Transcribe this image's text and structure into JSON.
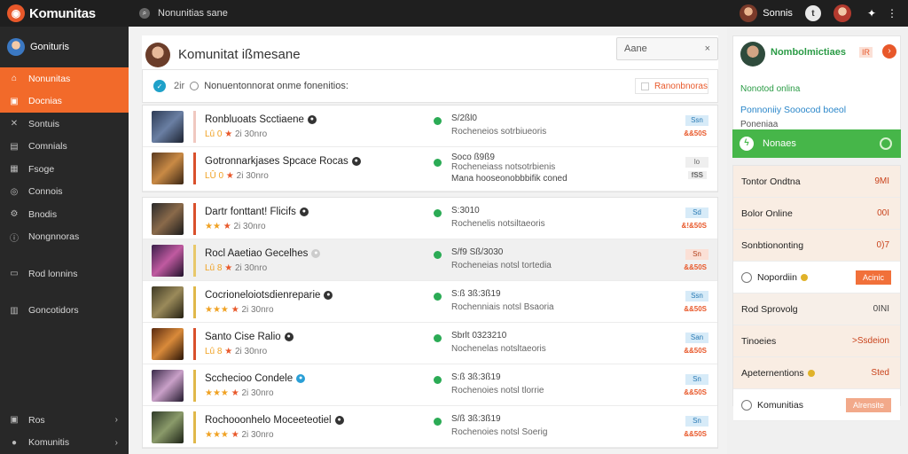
{
  "topbar": {
    "brand": "Komunitas",
    "search_text": "Nonunitias sane",
    "user_name": "Sonnis",
    "circle_label": "t",
    "icons": [
      "search-icon",
      "bell-icon",
      "more-icon"
    ]
  },
  "sidebar": {
    "profile_name": "Gonituris",
    "items": [
      {
        "label": "Nonunitas",
        "icon": "home-icon",
        "active": true
      },
      {
        "label": "Docnias",
        "icon": "folder-icon",
        "active": true
      },
      {
        "label": "Sontuis",
        "icon": "tools-icon"
      },
      {
        "label": "Comnials",
        "icon": "chat-icon"
      },
      {
        "label": "Fsoge",
        "icon": "grid-icon"
      },
      {
        "label": "Connois",
        "icon": "globe-icon"
      },
      {
        "label": "Bnodis",
        "icon": "settings-icon"
      },
      {
        "label": "Nongnnoras",
        "icon": "info-icon"
      },
      {
        "label": "Rod lonnins",
        "icon": "list-icon"
      },
      {
        "label": "Goncotidors",
        "icon": "doc-icon"
      }
    ],
    "bottom": [
      {
        "label": "Ros",
        "icon": "flag-icon"
      },
      {
        "label": "Komunitis",
        "icon": "user-icon"
      }
    ]
  },
  "header": {
    "title": "Komunitat ißmesane",
    "select_value": "Aane",
    "close_icon": "×"
  },
  "filter": {
    "count": "2ir",
    "text": "Nonuentonnorat onme fonenitios:",
    "button": "Ranonbnoras"
  },
  "rows_group1": [
    {
      "title": "Ronbluoats Scctiaene",
      "badge": "dark",
      "meta_a": "Lû 0",
      "meta_b": "2i 30nro",
      "info1": "S/2ßl0",
      "info2": "Rocheneios sotrbiueoris",
      "info3": "",
      "tag": "Ssn",
      "tag_style": "blue",
      "price": "&&50S",
      "price_style": "orange",
      "stripe": "#f0c8c0",
      "thumb": "linear-gradient(135deg,#2d3b55,#6a7fa3 50%,#1c2230)"
    },
    {
      "title": "Gotronnarkjases Spcace Rocas",
      "badge": "dark",
      "meta_a": "LÛ 0",
      "meta_b": "2i 30nro",
      "info1": "Soco ß9ß9",
      "info2": "Rocheneiass notsotrbienis",
      "info3": "Mana hooseonobbbifik coned",
      "tag": "lo",
      "tag_style": "gray",
      "price": "fSS",
      "price_style": "gray",
      "stripe": "#d9502c",
      "thumb": "linear-gradient(135deg,#5a3a1f,#c98a45 50%,#3a2614)"
    }
  ],
  "rows_group2": [
    {
      "title": "Dartr fonttant! Flicifs",
      "badge": "dark",
      "meta_a": "★★",
      "meta_b": "2i 30nro",
      "info1": "S:3010",
      "info2": "Rochenelis notsiltaeoris",
      "info3": "",
      "tag": "Sd",
      "tag_style": "blue",
      "price": "&!&50S",
      "price_style": "orange",
      "stripe": "#d9502c",
      "thumb": "linear-gradient(135deg,#2a2a2a,#8a6a4a 50%,#1b1b1b)",
      "hl": false
    },
    {
      "title": "Rocl Aaetiao Gecelhes",
      "badge": "gray",
      "meta_a": "Lû 8",
      "meta_b": "2i 30nro",
      "info1": "S/f9 Sß/3030",
      "info2": "Rocheneias notsl tortedia",
      "info3": "",
      "tag": "Sn",
      "tag_style": "red",
      "price": "&&50S",
      "price_style": "orange",
      "stripe": "#e8c86a",
      "thumb": "linear-gradient(135deg,#3a1f4a,#c05aa0 50%,#20122a)",
      "hl": true
    },
    {
      "title": "Cocrioneloiotsdienreparie",
      "badge": "dark",
      "meta_a": "★★★",
      "meta_b": "2i 30nro",
      "info1": "S:ß 3ß:3ß19",
      "info2": "Rochenniais notsl Bsaoria",
      "info3": "",
      "tag": "Ssn",
      "tag_style": "blue",
      "price": "&&50S",
      "price_style": "orange",
      "stripe": "#e0b84a",
      "thumb": "linear-gradient(135deg,#3f3a25,#9a8a5a 50%,#242012)",
      "hl": false
    },
    {
      "title": "Santo Cise Ralio",
      "badge": "dark",
      "meta_a": "Lû 8",
      "meta_b": "2i 30nro",
      "info1": "Sbrlt 0323210",
      "info2": "Nochenelas notsltaeoris",
      "info3": "",
      "tag": "San",
      "tag_style": "blue",
      "price": "&&50S",
      "price_style": "orange",
      "stripe": "#d9502c",
      "thumb": "linear-gradient(135deg,#5a2a10,#d98a3a 50%,#2a1406)",
      "hl": false
    },
    {
      "title": "Scchecioo Condele",
      "badge": "blue",
      "meta_a": "★★★",
      "meta_b": "2i 30nro",
      "info1": "S:ß 3ß:3ß19",
      "info2": "Rochenoies notsl tlorrie",
      "info3": "",
      "tag": "Sn",
      "tag_style": "blue",
      "price": "&&50S",
      "price_style": "orange",
      "stripe": "#e0b84a",
      "thumb": "linear-gradient(135deg,#3a2a4a,#c9a0c8 50%,#231a2e)",
      "hl": false
    },
    {
      "title": "Rochooonhelo Moceeteotiel",
      "badge": "dark",
      "meta_a": "★★★",
      "meta_b": "2i 30nro",
      "info1": "S/ß 3ß:3ß19",
      "info2": "Rochenoies notsl Soerig",
      "info3": "",
      "tag": "Sn",
      "tag_style": "blue",
      "price": "&&50S",
      "price_style": "orange",
      "stripe": "#e0b84a",
      "thumb": "linear-gradient(135deg,#2f3a28,#8a9a6a 50%,#1c2216)",
      "hl": false
    }
  ],
  "right_panel": {
    "name": "Nombolmictiaes",
    "count": "IR",
    "line1": "Nonotod onlina",
    "line2": "Ponnoniiy Sooocod boeol",
    "line3": "Poneniaa",
    "green_label": "Nonaes",
    "stats": [
      {
        "label": "Tontor Ondtna",
        "value": "9MI",
        "style": "orange"
      },
      {
        "label": "Bolor Online",
        "value": "00I",
        "style": "orange"
      },
      {
        "label": "Sonbtiononting",
        "value": "0)7",
        "style": "orange"
      },
      {
        "label": "Nopordiin",
        "value": "",
        "button": "Acinic",
        "style": "white",
        "icon": true,
        "dot": true
      },
      {
        "label": "Rod Sprovolg",
        "value": "0INI",
        "style": "orange-dark"
      },
      {
        "label": "Tinoeies",
        "value": ">Ssdeion",
        "style": "orange"
      },
      {
        "label": "Apeternentions",
        "value": "Sted",
        "style": "orange",
        "dot": true
      },
      {
        "label": "Komunitias",
        "value": "",
        "button": "Alrensite",
        "style": "white",
        "icon": true,
        "light": true
      }
    ]
  },
  "colors": {
    "accent": "#f26a2a",
    "green": "#46b649",
    "sidebar": "#282828"
  }
}
